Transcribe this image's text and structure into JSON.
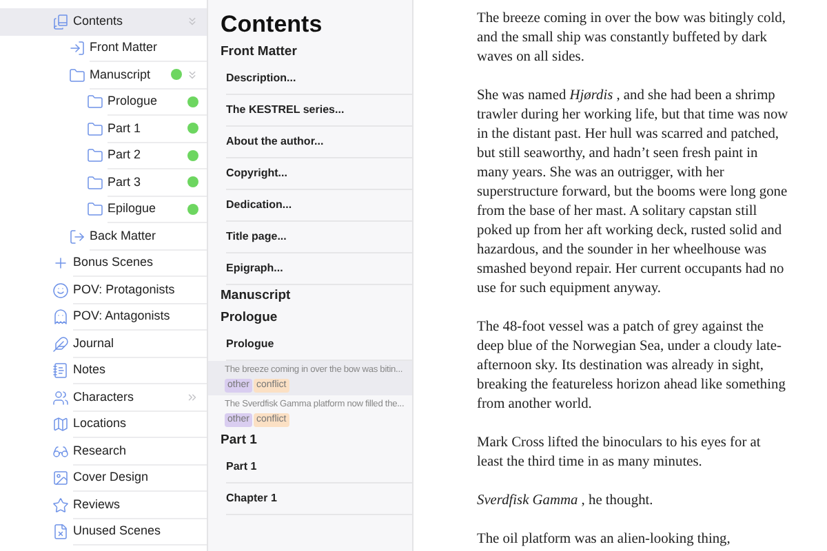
{
  "sidebar": {
    "items": [
      {
        "label": "Contents",
        "kind": "contents",
        "selected": true,
        "expanded": true,
        "children": [
          {
            "label": "Front Matter",
            "kind": "front",
            "selected": false
          },
          {
            "label": "Manuscript",
            "kind": "folder",
            "selected": false,
            "expanded": true,
            "color": "#6dd660",
            "children": [
              {
                "label": "Prologue",
                "kind": "folder",
                "selected": false,
                "color": "#6dd660"
              },
              {
                "label": "Part 1",
                "kind": "folder",
                "selected": false,
                "color": "#6dd660"
              },
              {
                "label": "Part 2",
                "kind": "folder",
                "selected": false,
                "color": "#6dd660"
              },
              {
                "label": "Part 3",
                "kind": "folder",
                "selected": false,
                "color": "#6dd660"
              },
              {
                "label": "Epilogue",
                "kind": "folder",
                "selected": false,
                "color": "#6dd660"
              }
            ]
          },
          {
            "label": "Back Matter",
            "kind": "back",
            "selected": false
          }
        ]
      },
      {
        "label": "Bonus Scenes",
        "kind": "plus",
        "selected": false
      },
      {
        "label": "POV: Protagonists",
        "kind": "smile",
        "selected": false
      },
      {
        "label": "POV: Antagonists",
        "kind": "ghost",
        "selected": false
      },
      {
        "label": "Journal",
        "kind": "feather",
        "selected": false
      },
      {
        "label": "Notes",
        "kind": "notebook",
        "selected": false
      },
      {
        "label": "Characters",
        "kind": "people",
        "selected": false,
        "expanded": false
      },
      {
        "label": "Locations",
        "kind": "map",
        "selected": false
      },
      {
        "label": "Research",
        "kind": "glasses",
        "selected": false
      },
      {
        "label": "Cover Design",
        "kind": "image",
        "selected": false
      },
      {
        "label": "Reviews",
        "kind": "star",
        "selected": false
      },
      {
        "label": "Unused Scenes",
        "kind": "file",
        "selected": false
      }
    ]
  },
  "contents": {
    "title": "Contents",
    "rows": [
      {
        "kind": "section",
        "text": "Front Matter"
      },
      {
        "kind": "item",
        "text": "Description..."
      },
      {
        "kind": "item",
        "text": "The KESTREL series..."
      },
      {
        "kind": "item",
        "text": "About the author..."
      },
      {
        "kind": "item",
        "text": "Copyright..."
      },
      {
        "kind": "item",
        "text": "Dedication..."
      },
      {
        "kind": "item",
        "text": "Title page..."
      },
      {
        "kind": "item",
        "text": "Epigraph..."
      },
      {
        "kind": "section",
        "text": "Manuscript"
      },
      {
        "kind": "section",
        "text": "Prologue"
      },
      {
        "kind": "item",
        "text": "Prologue"
      },
      {
        "kind": "scene",
        "text": "The breeze coming in over the bow was bitin...",
        "selected": true,
        "tags": [
          {
            "text": "other",
            "color": "#d9cdf0"
          },
          {
            "text": "conflict",
            "color": "#fbe0c4"
          }
        ]
      },
      {
        "kind": "scene",
        "text": "The Sverdfisk Gamma platform now filled the...",
        "selected": false,
        "tags": [
          {
            "text": "other",
            "color": "#d9cdf0"
          },
          {
            "text": "conflict",
            "color": "#fbe0c4"
          }
        ]
      },
      {
        "kind": "section",
        "text": "Part 1"
      },
      {
        "kind": "item",
        "text": "Part 1"
      },
      {
        "kind": "item",
        "text": "Chapter 1"
      }
    ]
  },
  "editor": {
    "paragraphs": [
      "The breeze coming in over the bow was bitingly cold, and the small ship was constantly buffeted by dark waves on all sides.",
      "She was named *Hjørdis* , and she had been a shrimp trawler during her working life, but that time was now in the distant past. Her hull was scarred and patched, but still seaworthy, and hadn’t seen fresh paint in many years. She was an outrigger, with her superstructure forward, but the booms were long gone from the base of her mast. A solitary capstan still poked up from her aft working deck, rusted solid and hazardous, and the sounder in her wheelhouse was smashed beyond repair. Her current occupants had no use for such equipment anyway.",
      "The 48-foot vessel was a patch of grey against the deep blue of the Norwegian Sea, under a cloudy late-afternoon sky. Its destination was already in sight, breaking the featureless horizon ahead like something from another world.",
      "Mark Cross lifted the binoculars to his eyes for at least the third time in as many minutes.",
      "*Sverdfisk Gamma* , he thought.",
      "The oil platform was an alien-looking thing,"
    ]
  }
}
